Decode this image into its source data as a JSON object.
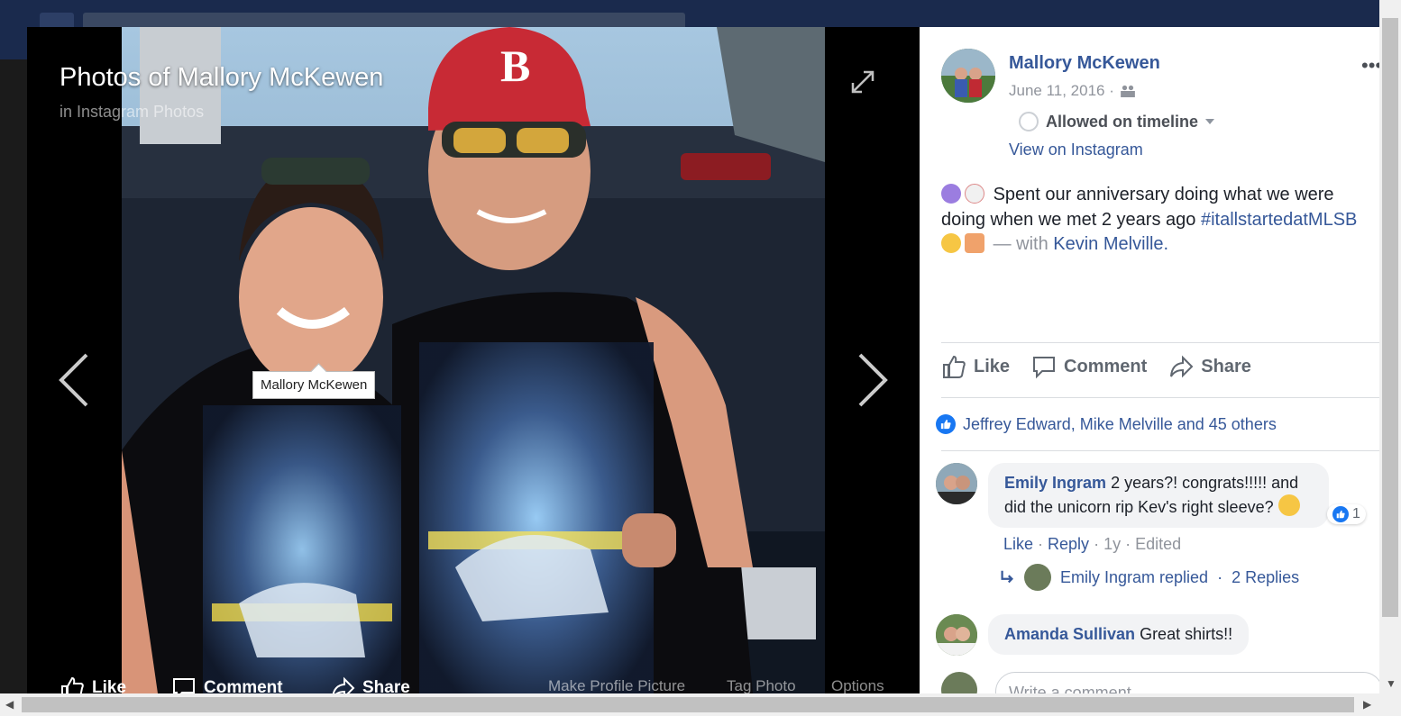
{
  "viewer": {
    "title": "Photos of Mallory McKewen",
    "subtitle": "in Instagram Photos",
    "tag_label": "Mallory McKewen",
    "actions": {
      "like": "Like",
      "comment": "Comment",
      "share": "Share"
    },
    "options": {
      "make_profile": "Make Profile Picture",
      "tag_photo": "Tag Photo",
      "options": "Options"
    }
  },
  "post": {
    "author": "Mallory McKewen",
    "date": "June 11, 2016 ·",
    "audience": "Allowed on timeline",
    "view_link": "View on Instagram",
    "caption_text": "Spent our anniversary doing what we were doing when we met 2 years ago",
    "hashtag": "#itallstartedatMLSB",
    "with_text": "— with",
    "with_name": "Kevin Melville.",
    "actions": {
      "like": "Like",
      "comment": "Comment",
      "share": "Share"
    },
    "likes": "Jeffrey Edward, Mike Melville and 45 others"
  },
  "comments": [
    {
      "name": "Emily Ingram",
      "text": "2 years?! congrats!!!!! and did the unicorn rip Kev's right sleeve?",
      "reactions": "1",
      "meta": {
        "like": "Like",
        "reply": "Reply",
        "time": "1y",
        "edited": "Edited"
      },
      "reply_summary": {
        "name": "Emily Ingram replied",
        "count": "2 Replies"
      }
    },
    {
      "name": "Amanda Sullivan",
      "text": "Great shirts!!"
    }
  ],
  "write_placeholder": "Write a comment...",
  "colors": {
    "link": "#365899",
    "accent": "#1877f2"
  }
}
